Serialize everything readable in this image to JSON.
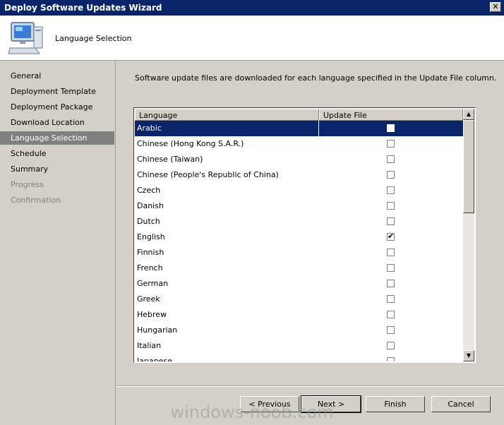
{
  "window": {
    "title": "Deploy Software Updates Wizard",
    "close_glyph": "✕"
  },
  "header": {
    "heading": "Language Selection",
    "icon": "computer-icon"
  },
  "sidebar": {
    "items": [
      {
        "label": "General",
        "state": "normal"
      },
      {
        "label": "Deployment Template",
        "state": "normal"
      },
      {
        "label": "Deployment Package",
        "state": "normal"
      },
      {
        "label": "Download Location",
        "state": "normal"
      },
      {
        "label": "Language Selection",
        "state": "active"
      },
      {
        "label": "Schedule",
        "state": "normal"
      },
      {
        "label": "Summary",
        "state": "normal"
      },
      {
        "label": "Progress",
        "state": "disabled"
      },
      {
        "label": "Confirmation",
        "state": "disabled"
      }
    ]
  },
  "main": {
    "description": "Software update files are downloaded for each language specified in the Update File column.",
    "columns": [
      "Language",
      "Update File"
    ],
    "rows": [
      {
        "language": "Arabic",
        "checked": false,
        "selected": true
      },
      {
        "language": "Chinese (Hong Kong S.A.R.)",
        "checked": false
      },
      {
        "language": "Chinese (Taiwan)",
        "checked": false
      },
      {
        "language": "Chinese (People's Republic of China)",
        "checked": false
      },
      {
        "language": "Czech",
        "checked": false
      },
      {
        "language": "Danish",
        "checked": false
      },
      {
        "language": "Dutch",
        "checked": false
      },
      {
        "language": "English",
        "checked": true
      },
      {
        "language": "Finnish",
        "checked": false
      },
      {
        "language": "French",
        "checked": false
      },
      {
        "language": "German",
        "checked": false
      },
      {
        "language": "Greek",
        "checked": false
      },
      {
        "language": "Hebrew",
        "checked": false
      },
      {
        "language": "Hungarian",
        "checked": false
      },
      {
        "language": "Italian",
        "checked": false
      },
      {
        "language": "Japanese",
        "checked": false
      }
    ]
  },
  "buttons": {
    "previous": "< Previous",
    "next": "Next >",
    "finish": "Finish",
    "cancel": "Cancel"
  },
  "watermark": "windows-noob.com",
  "colors": {
    "titlebar": "#0a246a",
    "selection": "#0a246a",
    "window_bg": "#d4d0c8"
  }
}
